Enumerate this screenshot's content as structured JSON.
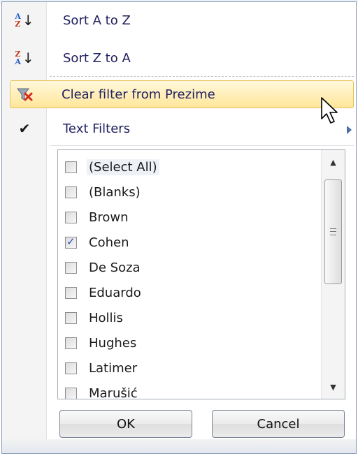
{
  "menu": {
    "sort_az": {
      "label": "Sort A to Z",
      "icon": "sort-a-to-z-icon"
    },
    "sort_za": {
      "label": "Sort Z to A",
      "icon": "sort-z-to-a-icon"
    },
    "clear_filter": {
      "label": "Clear filter from Prezime",
      "icon": "clear-filter-icon"
    },
    "text_filters": {
      "label": "Text Filters",
      "icon": "checkmark-icon"
    }
  },
  "list": {
    "items": [
      {
        "label": "(Select All)",
        "checked": false
      },
      {
        "label": "(Blanks)",
        "checked": false
      },
      {
        "label": "Brown",
        "checked": false
      },
      {
        "label": "Cohen",
        "checked": true
      },
      {
        "label": "De Soza",
        "checked": false
      },
      {
        "label": "Eduardo",
        "checked": false
      },
      {
        "label": "Hollis",
        "checked": false
      },
      {
        "label": "Hughes",
        "checked": false
      },
      {
        "label": "Latimer",
        "checked": false
      },
      {
        "label": "Marušić",
        "checked": false
      }
    ]
  },
  "buttons": {
    "ok": "OK",
    "cancel": "Cancel"
  },
  "colors": {
    "hover_bg": "#ffe69a",
    "hover_border": "#e9c256",
    "menu_text": "#1f1f5f",
    "check_blue": "#2a50b0"
  }
}
